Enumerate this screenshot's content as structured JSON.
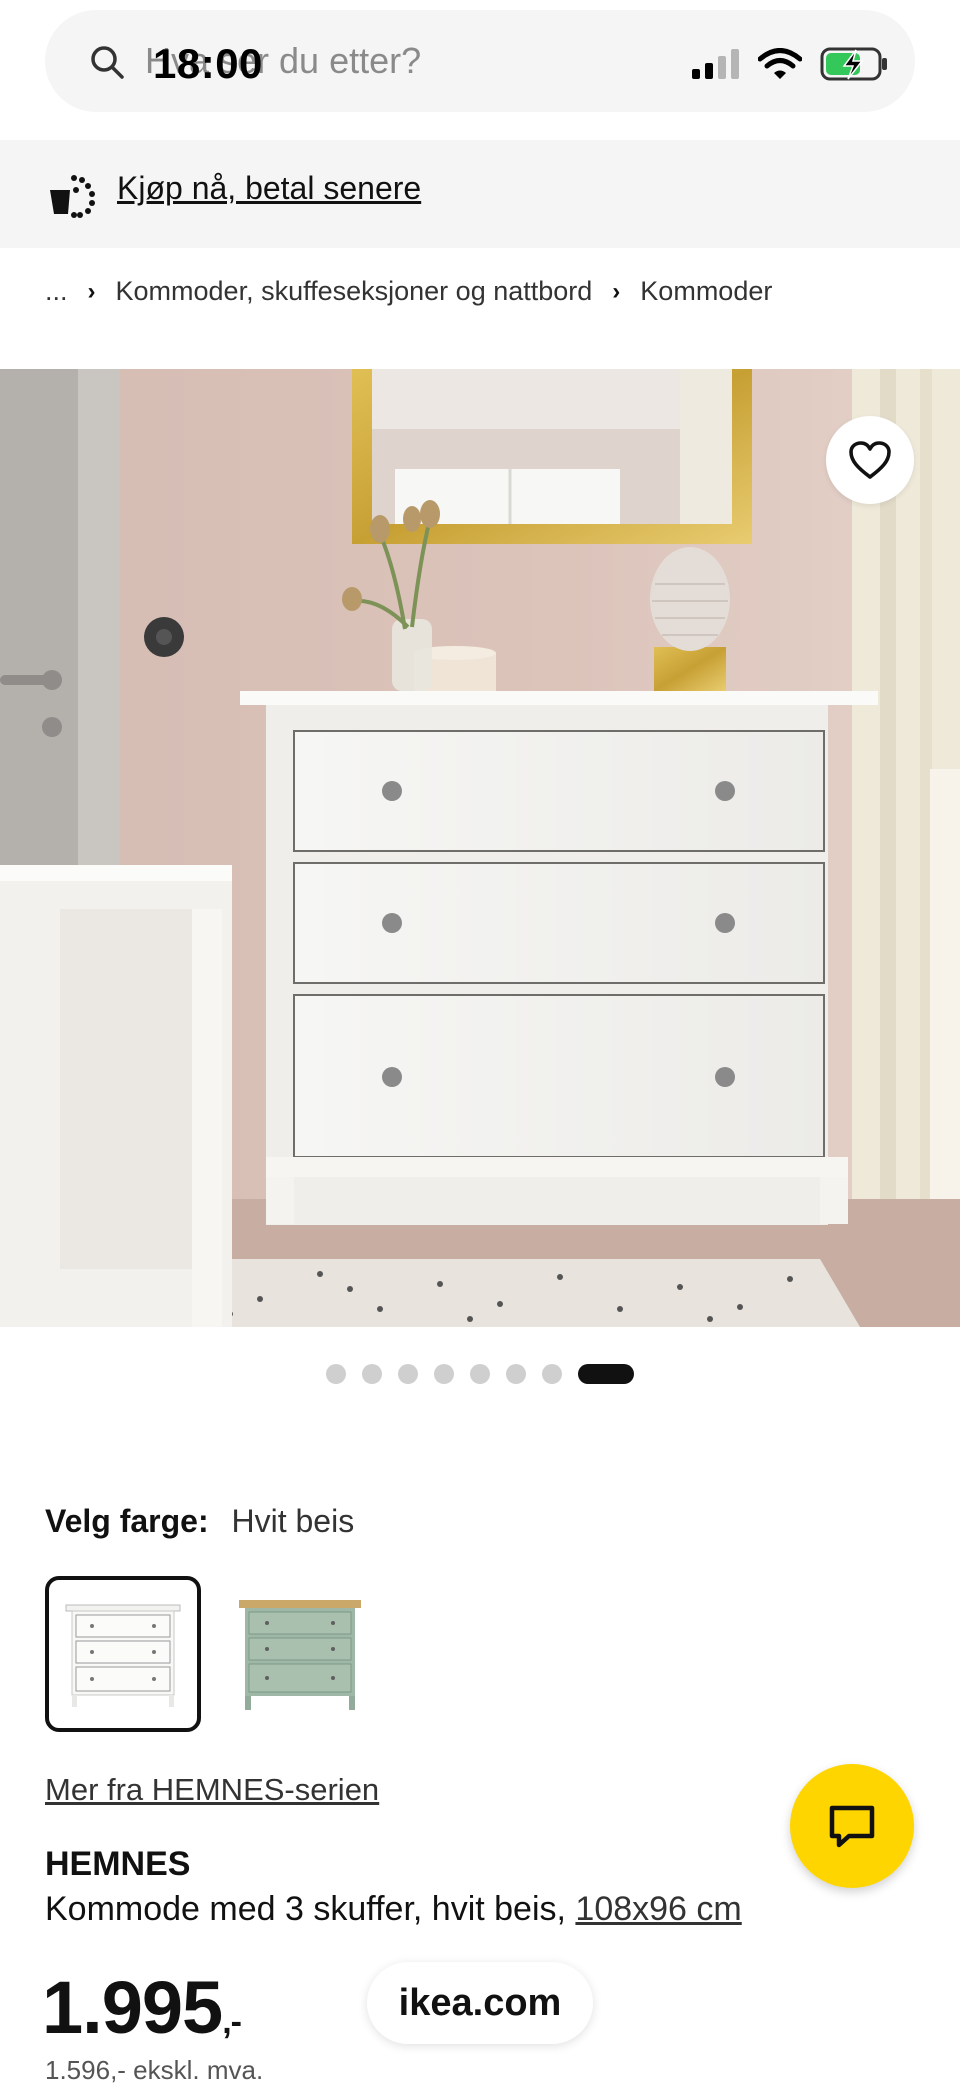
{
  "status_bar": {
    "time": "18:00"
  },
  "search": {
    "placeholder": "Hva ser du etter?"
  },
  "promo": {
    "link": "Kjøp nå, betal senere"
  },
  "breadcrumb": {
    "ellipsis": "...",
    "items": [
      "Kommoder, skuffeseksjoner og nattbord",
      "Kommoder"
    ]
  },
  "gallery": {
    "image_count": 8,
    "active_index": 7
  },
  "color": {
    "label": "Velg farge:",
    "value": "Hvit beis",
    "options": [
      "Hvit beis",
      "Grønn"
    ]
  },
  "series_link": "Mer fra HEMNES-serien",
  "product": {
    "name": "HEMNES",
    "description": "Kommode med 3 skuffer, hvit beis,",
    "size": "108x96 cm",
    "price": "1.995",
    "price_suffix": ",-",
    "price_ex_vat": "1.596,- ekskl. mva."
  },
  "browser": {
    "url": "ikea.com"
  },
  "colors": {
    "accent_yellow": "#ffd500",
    "promo_bg": "#f5f5f5",
    "text": "#111111"
  },
  "icons": [
    "search-icon",
    "signal-icon",
    "wifi-icon",
    "battery-icon",
    "cart-icon",
    "heart-icon",
    "chat-icon"
  ]
}
